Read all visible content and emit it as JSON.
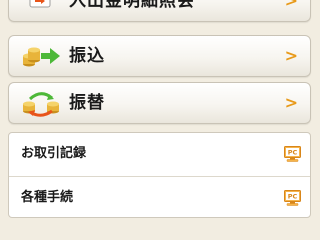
{
  "menu": {
    "items": [
      {
        "label": "入出金明細照会",
        "icon": "passbook-icon"
      },
      {
        "label": "振込",
        "icon": "coins-transfer-icon"
      },
      {
        "label": "振替",
        "icon": "coins-exchange-icon"
      }
    ]
  },
  "list": {
    "items": [
      {
        "label": "お取引記録",
        "icon": "pc-icon"
      },
      {
        "label": "各種手続",
        "icon": "pc-icon"
      }
    ]
  },
  "colors": {
    "accent": "#E89A1A",
    "background": "#F2EDE1",
    "arrow_green": "#4DB838"
  }
}
